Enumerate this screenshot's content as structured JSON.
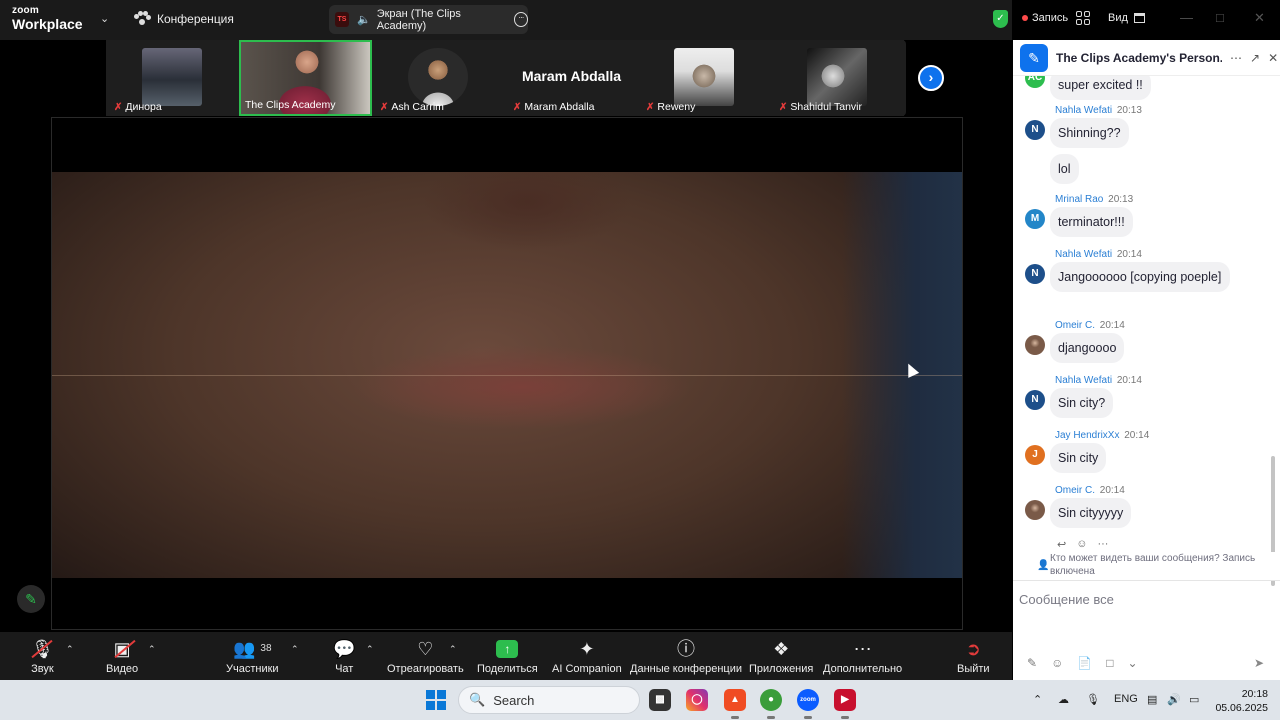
{
  "app": {
    "brand_top": "zoom",
    "brand_bottom": "Workplace",
    "conference_label": "Конференция"
  },
  "share_pill": {
    "label": "Экран (The Clips Academy)"
  },
  "top_right": {
    "record_label": "Запись",
    "view_label": "Вид"
  },
  "participants": [
    {
      "name": "Динора",
      "muted": true
    },
    {
      "name": "The Clips Academy",
      "muted": false,
      "active": true
    },
    {
      "name": "Ash Carrim",
      "muted": true
    },
    {
      "name": "Maram Abdalla",
      "muted": true,
      "display_name": "Maram Abdalla"
    },
    {
      "name": "Reweny",
      "muted": true
    },
    {
      "name": "Shahidul Tanvir",
      "muted": true
    }
  ],
  "toolbar": {
    "audio": "Звук",
    "video": "Видео",
    "participants": "Участники",
    "participants_count": "38",
    "chat": "Чат",
    "react": "Отреагировать",
    "share": "Поделиться",
    "ai": "AI Companion",
    "info": "Данные конференции",
    "apps": "Приложения",
    "more": "Дополнительно",
    "leave": "Выйти"
  },
  "chat": {
    "title": "The Clips Academy's Person...",
    "first_bubble": "super excited !!",
    "first_avatar": "AC",
    "messages": [
      {
        "sender": "Nahla Wefati",
        "time": "20:13",
        "avatar": "N",
        "color": "#1d4f8a",
        "texts": [
          "Shinning??",
          "lol"
        ]
      },
      {
        "sender": "Mrinal Rao",
        "time": "20:13",
        "avatar": "M",
        "color": "#2386c8",
        "texts": [
          "terminator!!!"
        ]
      },
      {
        "sender": "Nahla Wefati",
        "time": "20:14",
        "avatar": "N",
        "color": "#1d4f8a",
        "texts": [
          "Jangoooooo [copying poeple]"
        ]
      },
      {
        "sender": "Omeir C.",
        "time": "20:14",
        "avatar": "",
        "color": "#5a4a40",
        "texts": [
          "djangoooo"
        ]
      },
      {
        "sender": "Nahla Wefati",
        "time": "20:14",
        "avatar": "N",
        "color": "#1d4f8a",
        "texts": [
          "Sin city?"
        ]
      },
      {
        "sender": "Jay HendrixXx",
        "time": "20:14",
        "avatar": "J",
        "color": "#e07020",
        "texts": [
          "Sin city"
        ]
      },
      {
        "sender": "Omeir C.",
        "time": "20:14",
        "avatar": "",
        "color": "#5a4a40",
        "texts": [
          "Sin cityyyyy"
        ]
      }
    ],
    "notice": "Кто может видеть ваши сообщения? Запись включена",
    "compose_placeholder": "Сообщение все"
  },
  "taskbar": {
    "search_label": "Search",
    "lang": "ENG",
    "time": "20:18",
    "date": "05.06.2025"
  }
}
